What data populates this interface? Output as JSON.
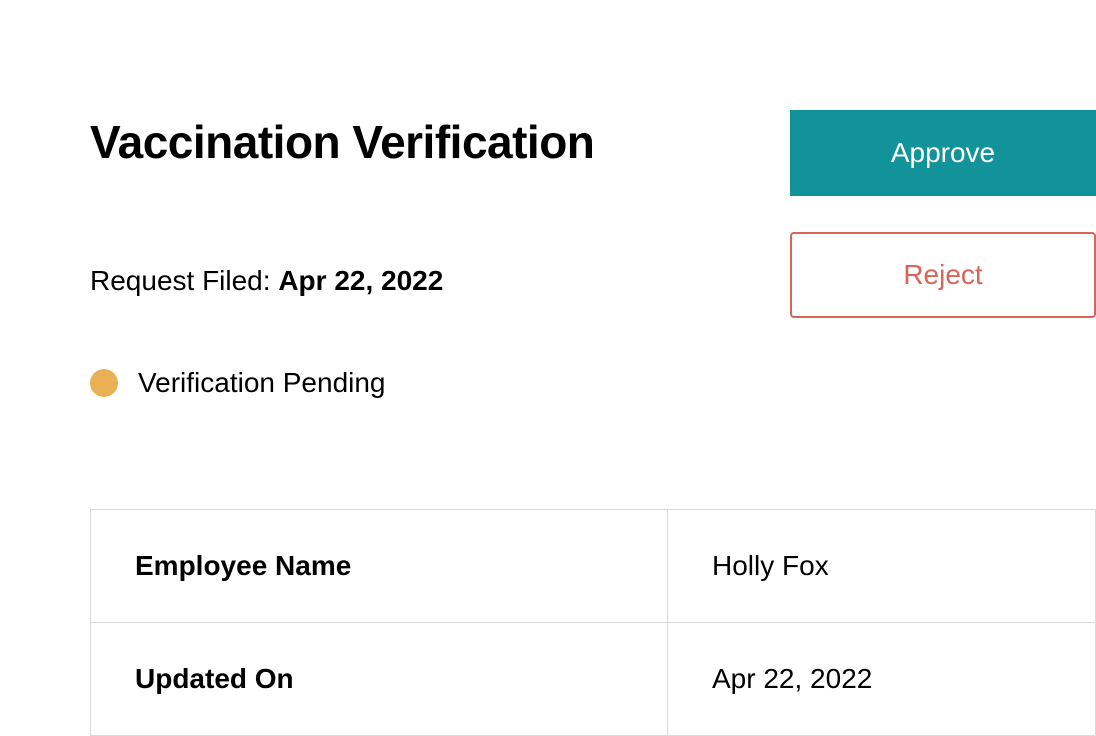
{
  "title": "Vaccination Verification",
  "request_filed": {
    "label": "Request Filed: ",
    "value": "Apr 22, 2022"
  },
  "status": {
    "text": "Verification Pending",
    "color": "#eab154"
  },
  "actions": {
    "approve": "Approve",
    "reject": "Reject"
  },
  "details": [
    {
      "label": "Employee Name",
      "value": "Holly Fox"
    },
    {
      "label": "Updated On",
      "value": "Apr 22, 2022"
    }
  ]
}
